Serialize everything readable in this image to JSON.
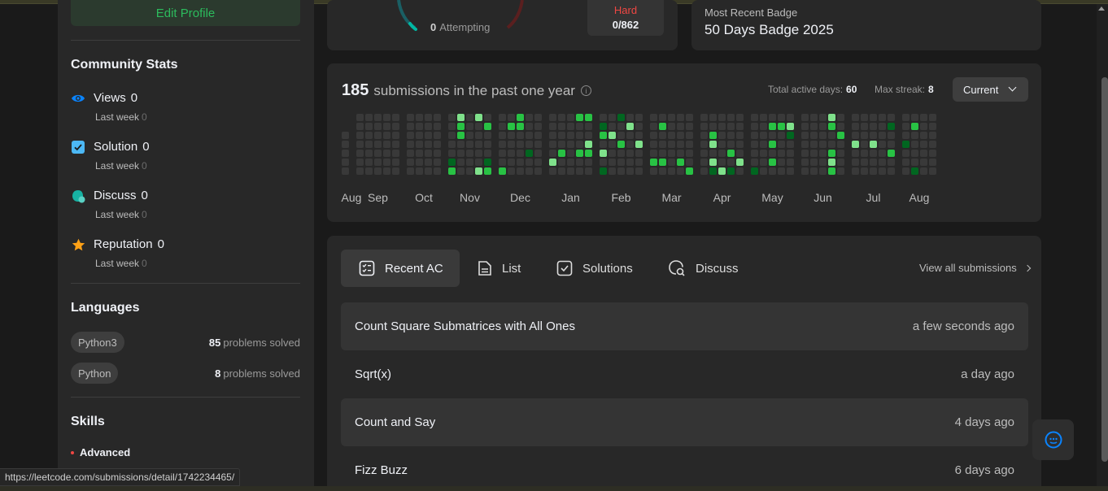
{
  "sidebar": {
    "edit_profile": "Edit Profile",
    "community_stats": {
      "title": "Community Stats",
      "items": [
        {
          "icon": "eye-icon",
          "label": "Views",
          "value": "0",
          "sub_label": "Last week",
          "sub_value": "0",
          "color": "#0a84ff"
        },
        {
          "icon": "solution-check-icon",
          "label": "Solution",
          "value": "0",
          "sub_label": "Last week",
          "sub_value": "0",
          "color": "#4cb8f5"
        },
        {
          "icon": "discuss-icon",
          "label": "Discuss",
          "value": "0",
          "sub_label": "Last week",
          "sub_value": "0",
          "color": "#17b2a3"
        },
        {
          "icon": "star-icon",
          "label": "Reputation",
          "value": "0",
          "sub_label": "Last week",
          "sub_value": "0",
          "color": "#ffa116"
        }
      ]
    },
    "languages": {
      "title": "Languages",
      "items": [
        {
          "name": "Python3",
          "count": "85",
          "suffix": "problems solved"
        },
        {
          "name": "Python",
          "count": "8",
          "suffix": "problems solved"
        }
      ]
    },
    "skills": {
      "title": "Skills",
      "first_level": "Advanced"
    }
  },
  "status_url": "https://leetcode.com/submissions/detail/1742234465/",
  "progress": {
    "attempting_count": "0",
    "attempting_label": "Attempting",
    "hard_label": "Hard",
    "hard_value": "0/862"
  },
  "badge": {
    "label": "Most Recent Badge",
    "name": "50 Days Badge 2025"
  },
  "heatmap": {
    "count": "185",
    "title_text": "submissions in the past one year",
    "info_icon": "i",
    "active_days_label": "Total active days:",
    "active_days": "60",
    "max_streak_label": "Max streak:",
    "max_streak": "8",
    "selector": "Current",
    "months": [
      "Aug",
      "Sep",
      "Oct",
      "Nov",
      "Dec",
      "Jan",
      "Feb",
      "Mar",
      "Apr",
      "May",
      "Jun",
      "Jul",
      "Aug"
    ],
    "colors": {
      "empty": "#393939",
      "l1": "#016620",
      "l2": "#28c244",
      "l3": "#7fe18b"
    }
  },
  "recent": {
    "tabs": [
      {
        "label": "Recent AC",
        "icon": "recent-ac-icon"
      },
      {
        "label": "List",
        "icon": "list-icon"
      },
      {
        "label": "Solutions",
        "icon": "solutions-icon"
      },
      {
        "label": "Discuss",
        "icon": "discuss-icon"
      }
    ],
    "view_all": "View all submissions",
    "submissions": [
      {
        "name": "Count Square Submatrices with All Ones",
        "time": "a few seconds ago"
      },
      {
        "name": "Sqrt(x)",
        "time": "a day ago"
      },
      {
        "name": "Count and Say",
        "time": "4 days ago"
      },
      {
        "name": "Fizz Buzz",
        "time": "6 days ago"
      }
    ]
  }
}
